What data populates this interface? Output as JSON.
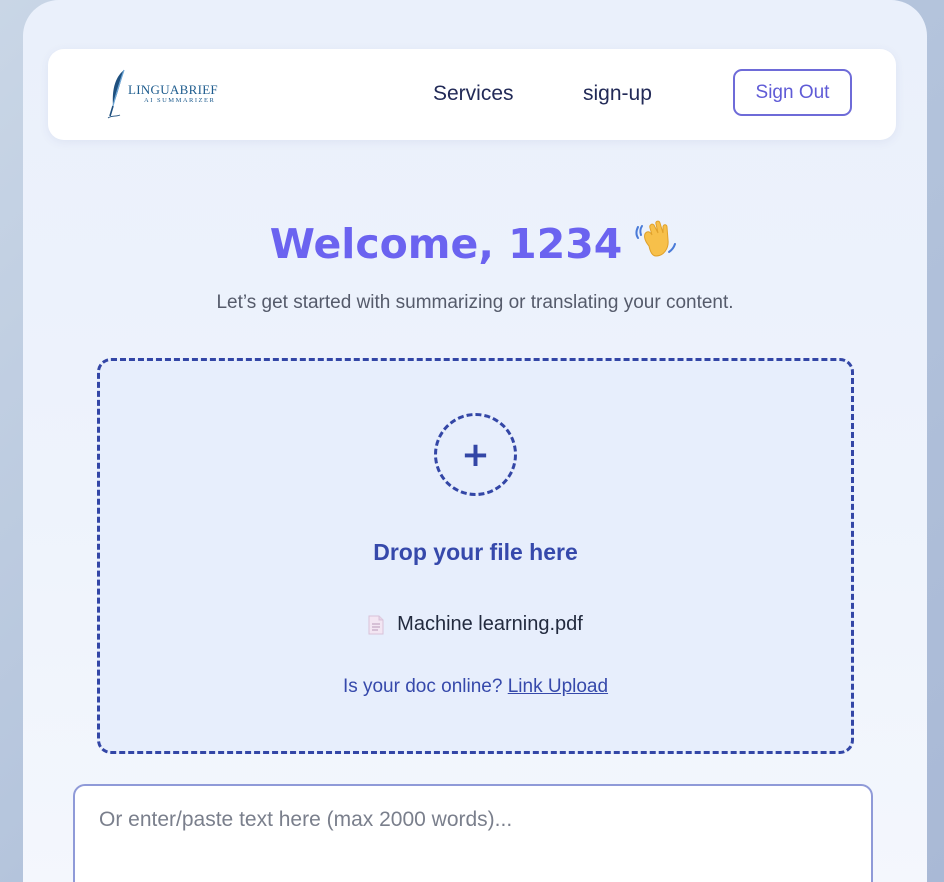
{
  "nav": {
    "logo_main": "LINGUABRIEF",
    "logo_sub": "AI SUMMARIZER",
    "services_label": "Services",
    "signup_label": "sign-up",
    "signout_label": "Sign Out"
  },
  "hero": {
    "welcome_text": "Welcome, 1234",
    "wave_icon": "waving-hand-emoji",
    "subtitle": "Let’s get started with summarizing or translating your content."
  },
  "dropzone": {
    "plus_symbol": "+",
    "title": "Drop your file here",
    "file_name": "Machine learning.pdf",
    "file_icon": "document-icon",
    "online_prompt": "Is your doc online?",
    "link_label": "Link Upload"
  },
  "text_input": {
    "placeholder": "Or enter/paste text here (max 2000 words)...",
    "value": ""
  },
  "colors": {
    "accent": "#6b63f0",
    "primary_dark": "#3346a6",
    "nav_text": "#222a57"
  }
}
